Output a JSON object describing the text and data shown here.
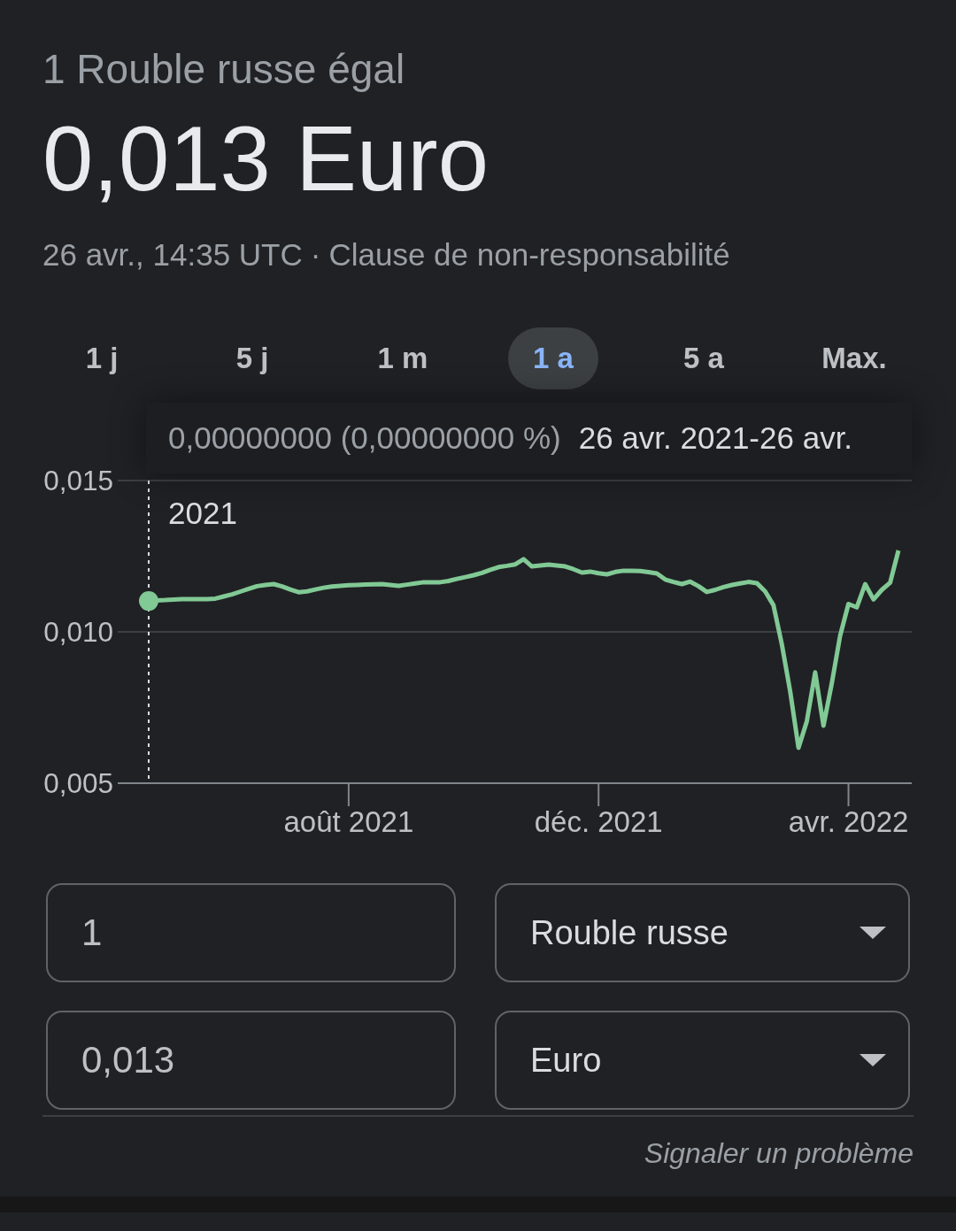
{
  "header": {
    "title": "1 Rouble russe égal",
    "value": "0,013 Euro",
    "timestamp": "26 avr., 14:35 UTC",
    "separator": "·",
    "disclaimer_link": "Clause de non-responsabilité"
  },
  "range_tabs": [
    {
      "label": "1 j",
      "selected": false
    },
    {
      "label": "5 j",
      "selected": false
    },
    {
      "label": "1 m",
      "selected": false
    },
    {
      "label": "1 a",
      "selected": true
    },
    {
      "label": "5 a",
      "selected": false
    },
    {
      "label": "Max.",
      "selected": false
    }
  ],
  "chart": {
    "tooltip": {
      "change": "0,00000000 (0,00000000 %)",
      "range": "26 avr. 2021-26 avr.",
      "range_continued": "2021"
    },
    "chart_data": {
      "type": "line",
      "categories": [
        null,
        null,
        null,
        null,
        null,
        null,
        null,
        null,
        null,
        null,
        null,
        null,
        null,
        null,
        null,
        null,
        null,
        null,
        null,
        null,
        null,
        null,
        null,
        null,
        "août 2021",
        null,
        null,
        null,
        null,
        null,
        null,
        null,
        null,
        null,
        null,
        null,
        null,
        null,
        null,
        null,
        null,
        null,
        null,
        null,
        null,
        null,
        null,
        null,
        null,
        null,
        null,
        null,
        null,
        null,
        "déc. 2021",
        null,
        null,
        null,
        null,
        null,
        null,
        null,
        null,
        null,
        null,
        null,
        null,
        null,
        null,
        null,
        null,
        null,
        null,
        null,
        null,
        null,
        null,
        null,
        null,
        null,
        null,
        null,
        null,
        null,
        "avr. 2022",
        null,
        null,
        null,
        null,
        null,
        null
      ],
      "series": [
        {
          "color": "#81c995",
          "values": [
            0.01102,
            0.01104,
            0.01105,
            0.01107,
            0.01108,
            0.01108,
            0.01108,
            0.01108,
            0.0111,
            0.01117,
            0.01124,
            0.01133,
            0.01142,
            0.01151,
            0.01155,
            0.01158,
            0.0115,
            0.0114,
            0.01131,
            0.01134,
            0.0114,
            0.01146,
            0.0115,
            0.01152,
            0.01154,
            0.01155,
            0.01156,
            0.01157,
            0.01158,
            0.01155,
            0.01152,
            0.01156,
            0.0116,
            0.01164,
            0.01164,
            0.01164,
            0.01168,
            0.01175,
            0.01181,
            0.01187,
            0.01195,
            0.01205,
            0.01214,
            0.01218,
            0.01223,
            0.0124,
            0.01216,
            0.01219,
            0.01222,
            0.01219,
            0.01216,
            0.01207,
            0.01196,
            0.01199,
            0.01194,
            0.0119,
            0.01198,
            0.01202,
            0.01202,
            0.01201,
            0.01197,
            0.01193,
            0.01173,
            0.01165,
            0.01158,
            0.01166,
            0.01151,
            0.01132,
            0.01139,
            0.01148,
            0.01155,
            0.0116,
            0.01165,
            0.01161,
            0.01134,
            0.01088,
            0.0096,
            0.00803,
            0.00617,
            0.00705,
            0.00866,
            0.0069,
            0.0083,
            0.00987,
            0.01092,
            0.01081,
            0.01158,
            0.01107,
            0.01139,
            0.01163,
            0.01269
          ]
        }
      ],
      "ylim": [
        0.005,
        0.015
      ],
      "yticks": [
        {
          "value": 0.005,
          "label": "0,005"
        },
        {
          "value": 0.01,
          "label": "0,010"
        },
        {
          "value": 0.015,
          "label": "0,015"
        }
      ],
      "ref_lines": [
        {
          "axis": "y",
          "value": 0.01
        }
      ]
    }
  },
  "converter": {
    "rows": [
      {
        "amount": "1",
        "currency": "Rouble russe"
      },
      {
        "amount": "0,013",
        "currency": "Euro"
      }
    ]
  },
  "footer": {
    "report_link": "Signaler un problème"
  }
}
